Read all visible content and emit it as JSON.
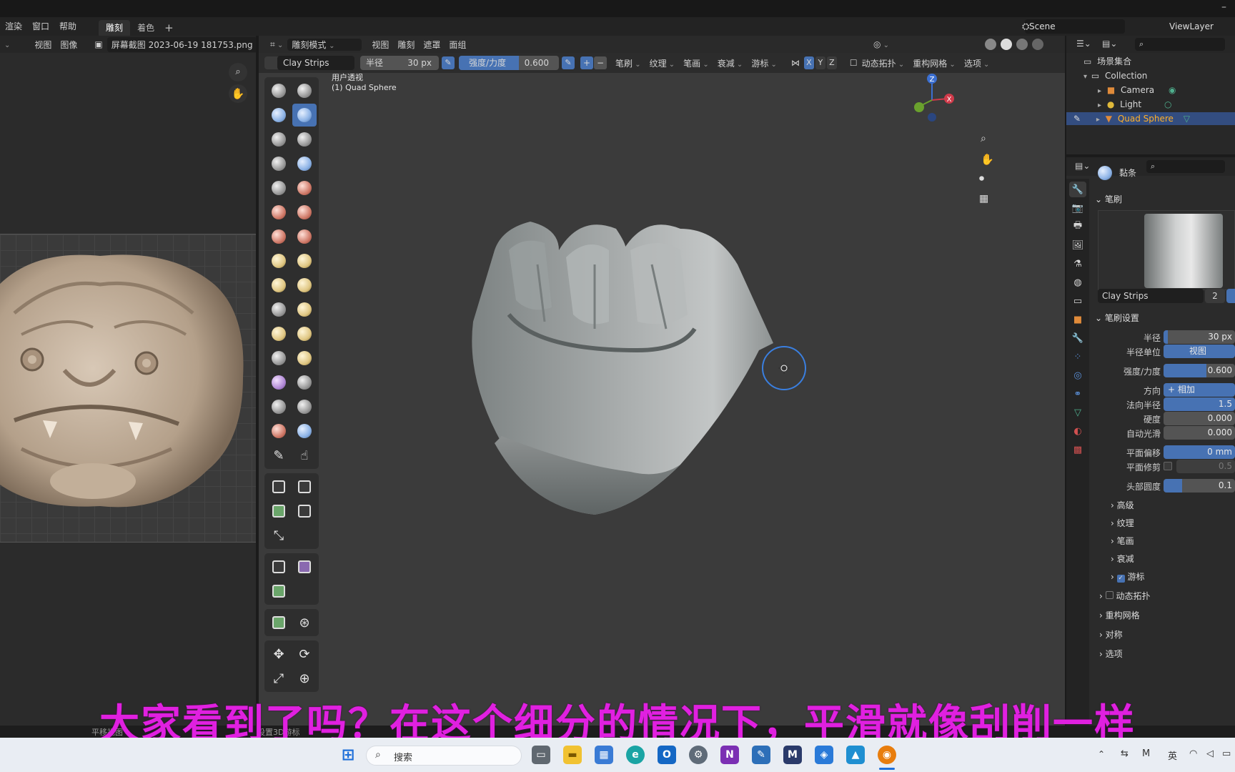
{
  "topbar": {
    "minimize_glyph": "–"
  },
  "menubar": {
    "items": [
      "渲染",
      "窗口",
      "帮助"
    ],
    "tabs": [
      {
        "label": "雕刻",
        "active": true
      },
      {
        "label": "着色",
        "active": false
      }
    ],
    "add_tab": "+",
    "scene": "Scene",
    "view_layer": "ViewLayer"
  },
  "image_editor": {
    "menu": [
      "视图",
      "图像"
    ],
    "image_name": "屏幕截图 2023-06-19 181753.png"
  },
  "viewport": {
    "mode": "雕刻模式",
    "menus": [
      "视图",
      "雕刻",
      "遮罩",
      "面组"
    ],
    "brush_name": "Clay Strips",
    "radius_label": "半径",
    "radius_value": "30 px",
    "strength_label": "强度/力度",
    "strength_value": "0.600",
    "strength_fraction": 0.6,
    "tool_menus": [
      "笔刷",
      "纹理",
      "笔画",
      "衰减",
      "游标"
    ],
    "axes": [
      "X",
      "Y",
      "Z"
    ],
    "dyntopo": "动态拓扑",
    "remesh": "重构网格",
    "options": "选项",
    "view_name": "用户透视",
    "object_name": "(1) Quad Sphere",
    "gizmo_z": "Z",
    "gizmo_x": "X"
  },
  "outliner": {
    "root": "场景集合",
    "collection": "Collection",
    "items": [
      "Camera",
      "Light",
      "Quad Sphere"
    ]
  },
  "properties": {
    "active_brush_label": "黏条",
    "brush_section": "笔刷",
    "brush_name": "Clay Strips",
    "brush_users": "2",
    "settings_section": "笔刷设置",
    "rows": [
      {
        "label": "半径",
        "value": "30 px"
      },
      {
        "label": "半径单位",
        "value": "视图"
      },
      {
        "label": "强度/力度",
        "value": "0.600"
      },
      {
        "label": "方向",
        "value": "+   相加"
      },
      {
        "label": "法向半径",
        "value": "1.5"
      },
      {
        "label": "硬度",
        "value": "0.000"
      },
      {
        "label": "自动光滑",
        "value": "0.000"
      },
      {
        "label": "平面偏移",
        "value": "0 mm"
      },
      {
        "label": "平面修剪",
        "value": "0.5"
      },
      {
        "label": "头部圆度",
        "value": "0.1"
      }
    ],
    "subpanels": [
      "高级",
      "纹理",
      "笔画",
      "衰减",
      "游标"
    ],
    "panels": [
      "动态拓扑",
      "重构网格",
      "对称",
      "选项"
    ]
  },
  "statusbar": {
    "left": "平移视图",
    "middle": "设置3D游标"
  },
  "subtitle": "大家看到了吗？在这个细分的情况下，平滑就像刮削一样",
  "taskbar": {
    "search": "搜索",
    "ime": "英"
  }
}
